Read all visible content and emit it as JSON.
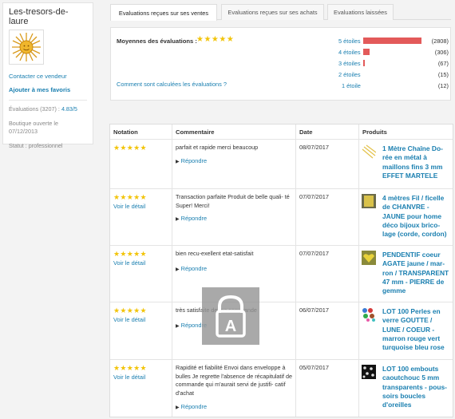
{
  "sidebar": {
    "shop_name": "Les-tresors-de-laure",
    "contact_link": "Contacter ce vendeur",
    "favorites_link": "Ajouter à mes favoris",
    "evaluations_label": "Évaluations (3207) :",
    "evaluations_score": "4.83/5",
    "opened_line1": "Boutique ouverte le",
    "opened_line2": "07/12/2013",
    "status": "Statut : professionnel"
  },
  "tabs": [
    {
      "label": "Evaluations reçues sur ses ventes",
      "active": true
    },
    {
      "label": "Evaluations reçues sur ses achats",
      "active": false
    },
    {
      "label": "Evaluations laissées",
      "active": false
    }
  ],
  "summary": {
    "average_label": "Moyennes des évaluations :",
    "average_stars": "★★★★★",
    "calc_link": "Comment sont calculées les évaluations ?",
    "histogram": [
      {
        "label": "5 étoiles",
        "count": "(2808)",
        "value": 2808
      },
      {
        "label": "4 étoiles",
        "count": "(306)",
        "value": 306
      },
      {
        "label": "3 étoiles",
        "count": "(67)",
        "value": 67
      },
      {
        "label": "2 étoiles",
        "count": "(15)",
        "value": 15
      },
      {
        "label": "1 étoile",
        "count": "(12)",
        "value": 12
      }
    ],
    "bar_color": "#e35a5a"
  },
  "table": {
    "headers": {
      "rating": "Notation",
      "comment": "Commentaire",
      "date": "Date",
      "products": "Produits"
    },
    "rows": [
      {
        "stars": "★★★★★",
        "detail": "",
        "comment": "parfait et rapide merci beaucoup",
        "reply": "Répondre",
        "date": "08/07/2017",
        "product_lines": [
          "1 Mètre Chaîne Do-",
          "rée en métal à",
          "maillons fins 3 mm",
          "EFFET MARTELE"
        ]
      },
      {
        "stars": "★★★★★",
        "detail": "Voir le détail",
        "comment": "Transaction parfaite Produit de belle quali- té Super! Merci!",
        "reply": "Répondre",
        "date": "07/07/2017",
        "product_lines": [
          "4 mètres Fil / ficelle",
          "de CHANVRE -",
          "JAUNE pour home",
          "déco bijoux brico-",
          "lage (corde, cordon)"
        ]
      },
      {
        "stars": "★★★★★",
        "detail": "Voir le détail",
        "comment": "bien recu-exellent etat-satisfait",
        "reply": "Répondre",
        "date": "07/07/2017",
        "product_lines": [
          "PENDENTIF coeur",
          "AGATE jaune / mar-",
          "ron / TRANSPARENT",
          "47 mm - PIERRE de",
          "gemme"
        ]
      },
      {
        "stars": "★★★★★",
        "detail": "Voir le détail",
        "comment": "très satisfaite de ma commande",
        "reply": "Répondre",
        "date": "06/07/2017",
        "product_lines": [
          "LOT 100 Perles en",
          "verre GOUTTE /",
          "LUNE / COEUR -",
          "marron rouge vert",
          "turquoise bleu rose"
        ]
      },
      {
        "stars": "★★★★★",
        "detail": "Voir le détail",
        "comment": "Rapidité et fiabilité Envoi dans enveloppe à bulles Je regrette l'absence de récapitulatif de commande qui m'aurait servi de justifi- catif d'achat",
        "reply": "Répondre",
        "date": "05/07/2017",
        "product_lines": [
          "LOT 100 embouts",
          "caoutchouc 5 mm",
          "transparents - pous-",
          "soirs boucles",
          "d'oreilles"
        ]
      }
    ]
  },
  "colors": {
    "link": "#1a7fb0",
    "star": "#f2c40a"
  },
  "watermark_icon": "lock-a-icon"
}
